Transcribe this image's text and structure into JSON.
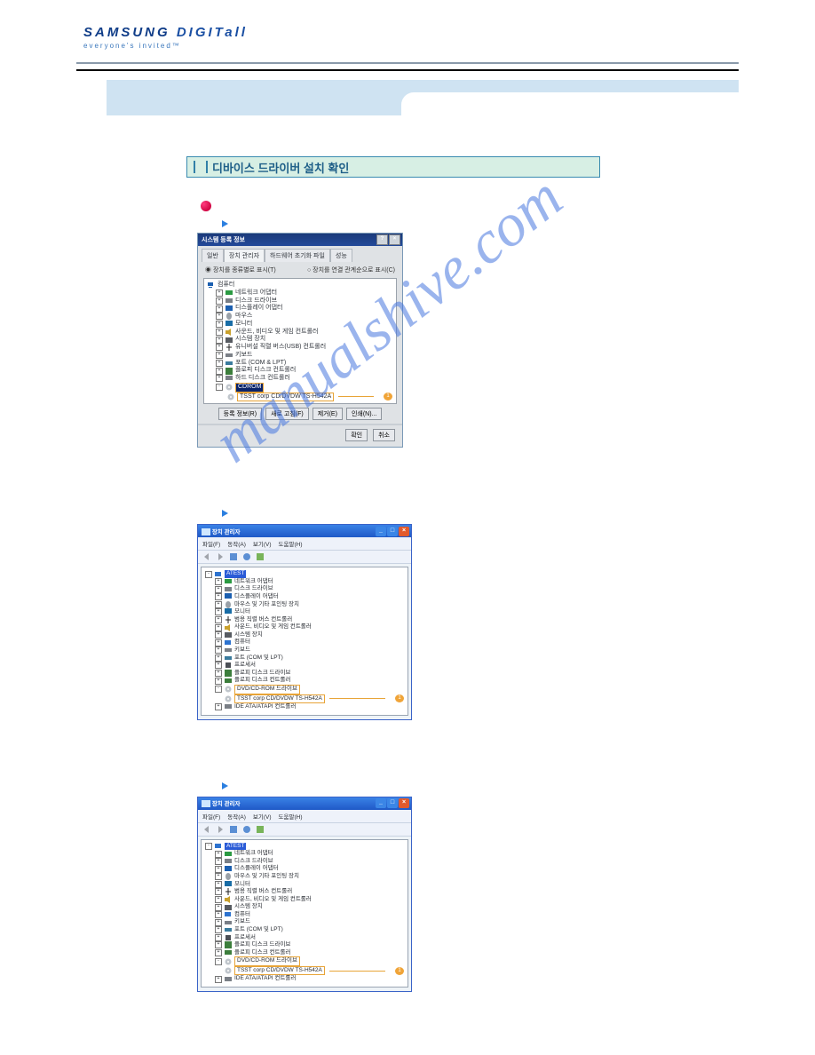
{
  "logo": {
    "brand_left": "SAMSUNG ",
    "brand_right": "DIGITall",
    "tagline": "everyone's invited™"
  },
  "section_title": "디바이스 드라이버 설치 확인",
  "watermark": "manualshive.com",
  "win98": {
    "title": "시스템 등록 정보",
    "tabs": [
      "일반",
      "장치 관리자",
      "하드웨어 초기화 파일",
      "성능"
    ],
    "radios": [
      "장치를 종류별로 표시(T)",
      "장치를 연결 관계순으로 표시(C)"
    ],
    "tree": {
      "root": "컴퓨터",
      "items": [
        "네트워크 어댑터",
        "디스크 드라이브",
        "디스플레이 어댑터",
        "마우스",
        "모니터",
        "사운드, 비디오 및 게임 컨트롤러",
        "시스템 장치",
        "유니버설 직렬 버스(USB) 컨트롤러",
        "키보드",
        "포트 (COM & LPT)",
        "플로피 디스크 컨트롤러",
        "하드 디스크 컨트롤러"
      ],
      "cdrom_label": "CDROM",
      "device": "TSST corp CD/DVDW TS-H542A",
      "callout": "1"
    },
    "buttons": [
      "등록 정보(R)",
      "새로 고침(F)",
      "제거(E)",
      "인쇄(N)..."
    ],
    "ok": "확인",
    "cancel": "취소"
  },
  "winxp_a": {
    "title": "장치 관리자",
    "menubar": [
      "파일(F)",
      "동작(A)",
      "보기(V)",
      "도움말(H)"
    ],
    "tree": {
      "root": "ATEST",
      "items": [
        "네트워크 어댑터",
        "디스크 드라이브",
        "디스플레이 어댑터",
        "마우스 및 기타 포인팅 장치",
        "모니터",
        "범용 직렬 버스 컨트롤러",
        "사운드, 비디오 및 게임 컨트롤러",
        "시스템 장치",
        "컴퓨터",
        "키보드",
        "포트 (COM 및 LPT)",
        "프로세서",
        "플로피 디스크 드라이브",
        "플로피 디스크 컨트롤러"
      ],
      "dvd_label": "DVD/CD-ROM 드라이브",
      "device": "TSST corp CD/DVDW TS-H542A",
      "ide": "IDE ATA/ATAPI 컨트롤러",
      "callout": "1"
    }
  },
  "winxp_b": {
    "title": "장치 관리자",
    "menubar": [
      "파일(F)",
      "동작(A)",
      "보기(V)",
      "도움말(H)"
    ],
    "tree": {
      "root": "ATEST",
      "items": [
        "네트워크 어댑터",
        "디스크 드라이브",
        "디스플레이 어댑터",
        "마우스 및 기타 포인팅 장치",
        "모니터",
        "범용 직렬 버스 컨트롤러",
        "사운드, 비디오 및 게임 컨트롤러",
        "시스템 장치",
        "컴퓨터",
        "키보드",
        "포트 (COM 및 LPT)",
        "프로세서",
        "플로피 디스크 드라이브",
        "플로피 디스크 컨트롤러"
      ],
      "dvd_label": "DVD/CD-ROM 드라이브",
      "device": "TSST corp CD/DVDW TS-H542A",
      "ide": "IDE ATA/ATAPI 컨트롤러",
      "callout": "1"
    }
  }
}
